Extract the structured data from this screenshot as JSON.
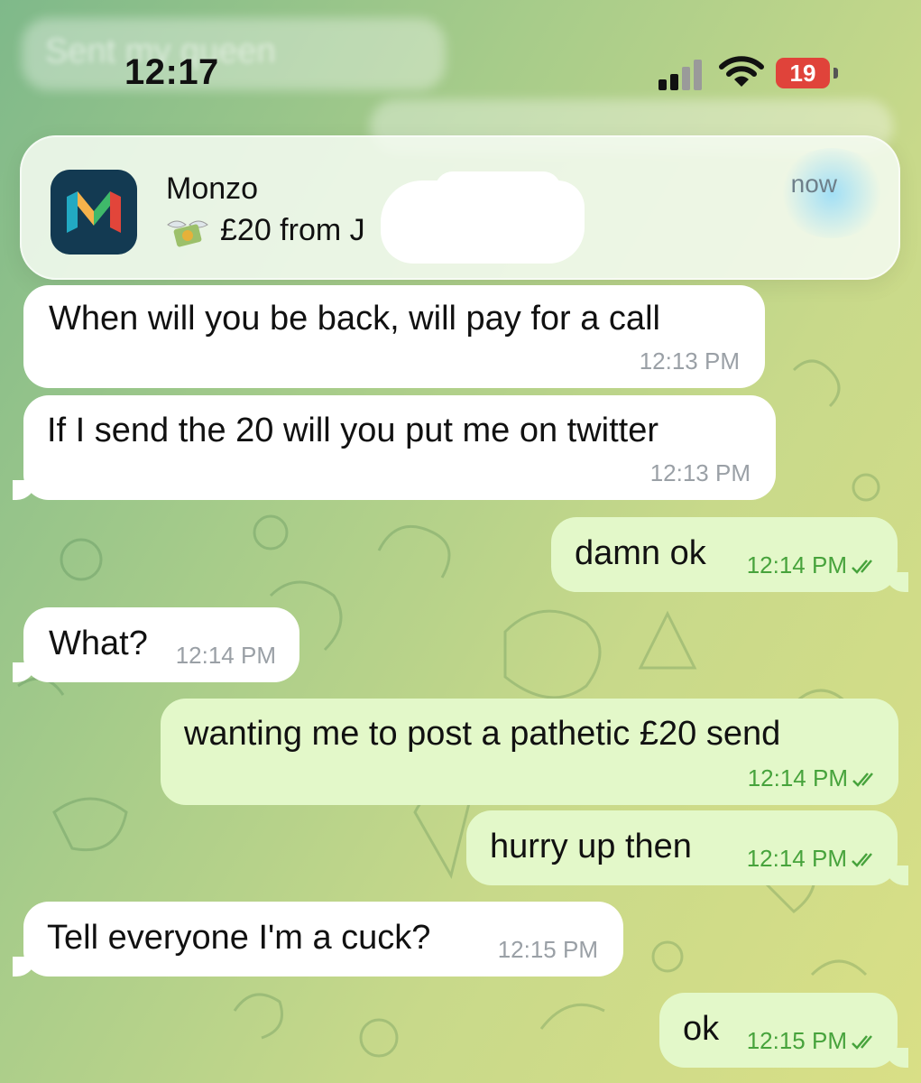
{
  "background_ghost": {
    "text": "Sent my queen"
  },
  "status_bar": {
    "time": "12:17",
    "battery": "19",
    "icons": [
      "cellular-signal-icon",
      "wifi-icon",
      "battery-icon"
    ]
  },
  "notification": {
    "app_name": "Monzo",
    "body": "£20 from J",
    "time": "now",
    "icon": "monzo-app-icon",
    "emoji_icon": "money-with-wings-icon"
  },
  "messages": [
    {
      "direction": "incoming",
      "text": "When will you be back, will pay for a call",
      "time": "12:13 PM"
    },
    {
      "direction": "incoming",
      "text": "If I send the 20 will you put me on twitter",
      "time": "12:13 PM"
    },
    {
      "direction": "outgoing",
      "text": "damn ok",
      "time": "12:14 PM",
      "read": true
    },
    {
      "direction": "incoming",
      "text": "What?",
      "time": "12:14 PM"
    },
    {
      "direction": "outgoing",
      "text": "wanting me to post a pathetic £20 send",
      "time": "12:14 PM",
      "read": true
    },
    {
      "direction": "outgoing",
      "text": "hurry up then",
      "time": "12:14 PM",
      "read": true
    },
    {
      "direction": "incoming",
      "text": "Tell everyone I'm a cuck?",
      "time": "12:15 PM"
    },
    {
      "direction": "outgoing",
      "text": "ok",
      "time": "12:15 PM",
      "read": true
    }
  ],
  "colors": {
    "incoming_bubble": "#ffffff",
    "outgoing_bubble": "#e3f8c9",
    "outgoing_time": "#47a33c",
    "battery_low": "#e0433a"
  }
}
